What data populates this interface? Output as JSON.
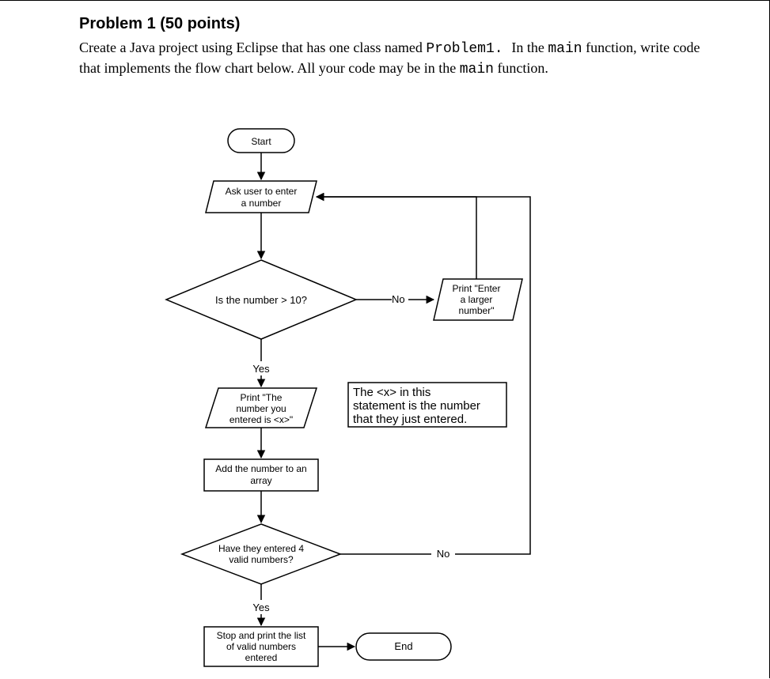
{
  "header": {
    "title": "Problem 1 (50 points)",
    "desc_parts": [
      "Create a Java project using Eclipse that has one class named ",
      "Problem1. ",
      "  In the ",
      "main",
      " function, write code that implements the flow chart below. All your code may be in the ",
      "main",
      " function."
    ]
  },
  "flow": {
    "start": "Start",
    "end": "End",
    "input_prompt_l1": "Ask user to enter",
    "input_prompt_l2": "a number",
    "decision1": "Is the number > 10?",
    "decision1_no": "No",
    "decision1_yes": "Yes",
    "print_larger_l1": "Print \"Enter",
    "print_larger_l2": "a larger",
    "print_larger_l3": "number\"",
    "print_entered_l1": "Print \"The",
    "print_entered_l2": "number you",
    "print_entered_l3": "entered is <x>\"",
    "note_l1": "The <x> in this",
    "note_l2": "statement is the number",
    "note_l3": "that they just entered.",
    "add_array_l1": "Add the number to an",
    "add_array_l2": "array",
    "decision2_l1": "Have they entered 4",
    "decision2_l2": "valid numbers?",
    "decision2_no": "No",
    "decision2_yes": "Yes",
    "stop_l1": "Stop and print the list",
    "stop_l2": "of valid numbers",
    "stop_l3": "entered"
  }
}
